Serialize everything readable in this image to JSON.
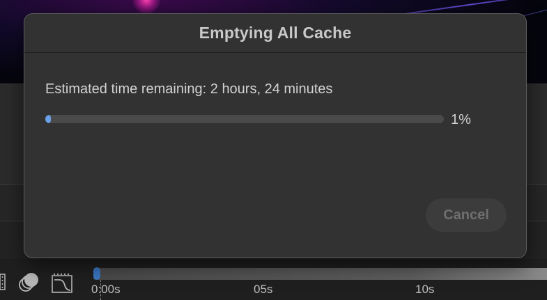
{
  "dialog": {
    "title": "Emptying All Cache",
    "status_text": "Estimated time remaining: 2 hours, 24 minutes",
    "progress_percent_label": "1%",
    "progress_value": 0.01,
    "cancel_label": "Cancel",
    "cancel_enabled": false
  },
  "timeline": {
    "tick_labels": [
      "0:00s",
      "05s",
      "10s"
    ]
  },
  "colors": {
    "progress_fill": "#6aa0e8",
    "dialog_background": "#323232",
    "accent_handle": "#3b77c4"
  },
  "icons": {
    "tool_1": "film-strip-icon",
    "tool_2": "motion-blur-icon",
    "tool_3": "graph-editor-icon"
  }
}
